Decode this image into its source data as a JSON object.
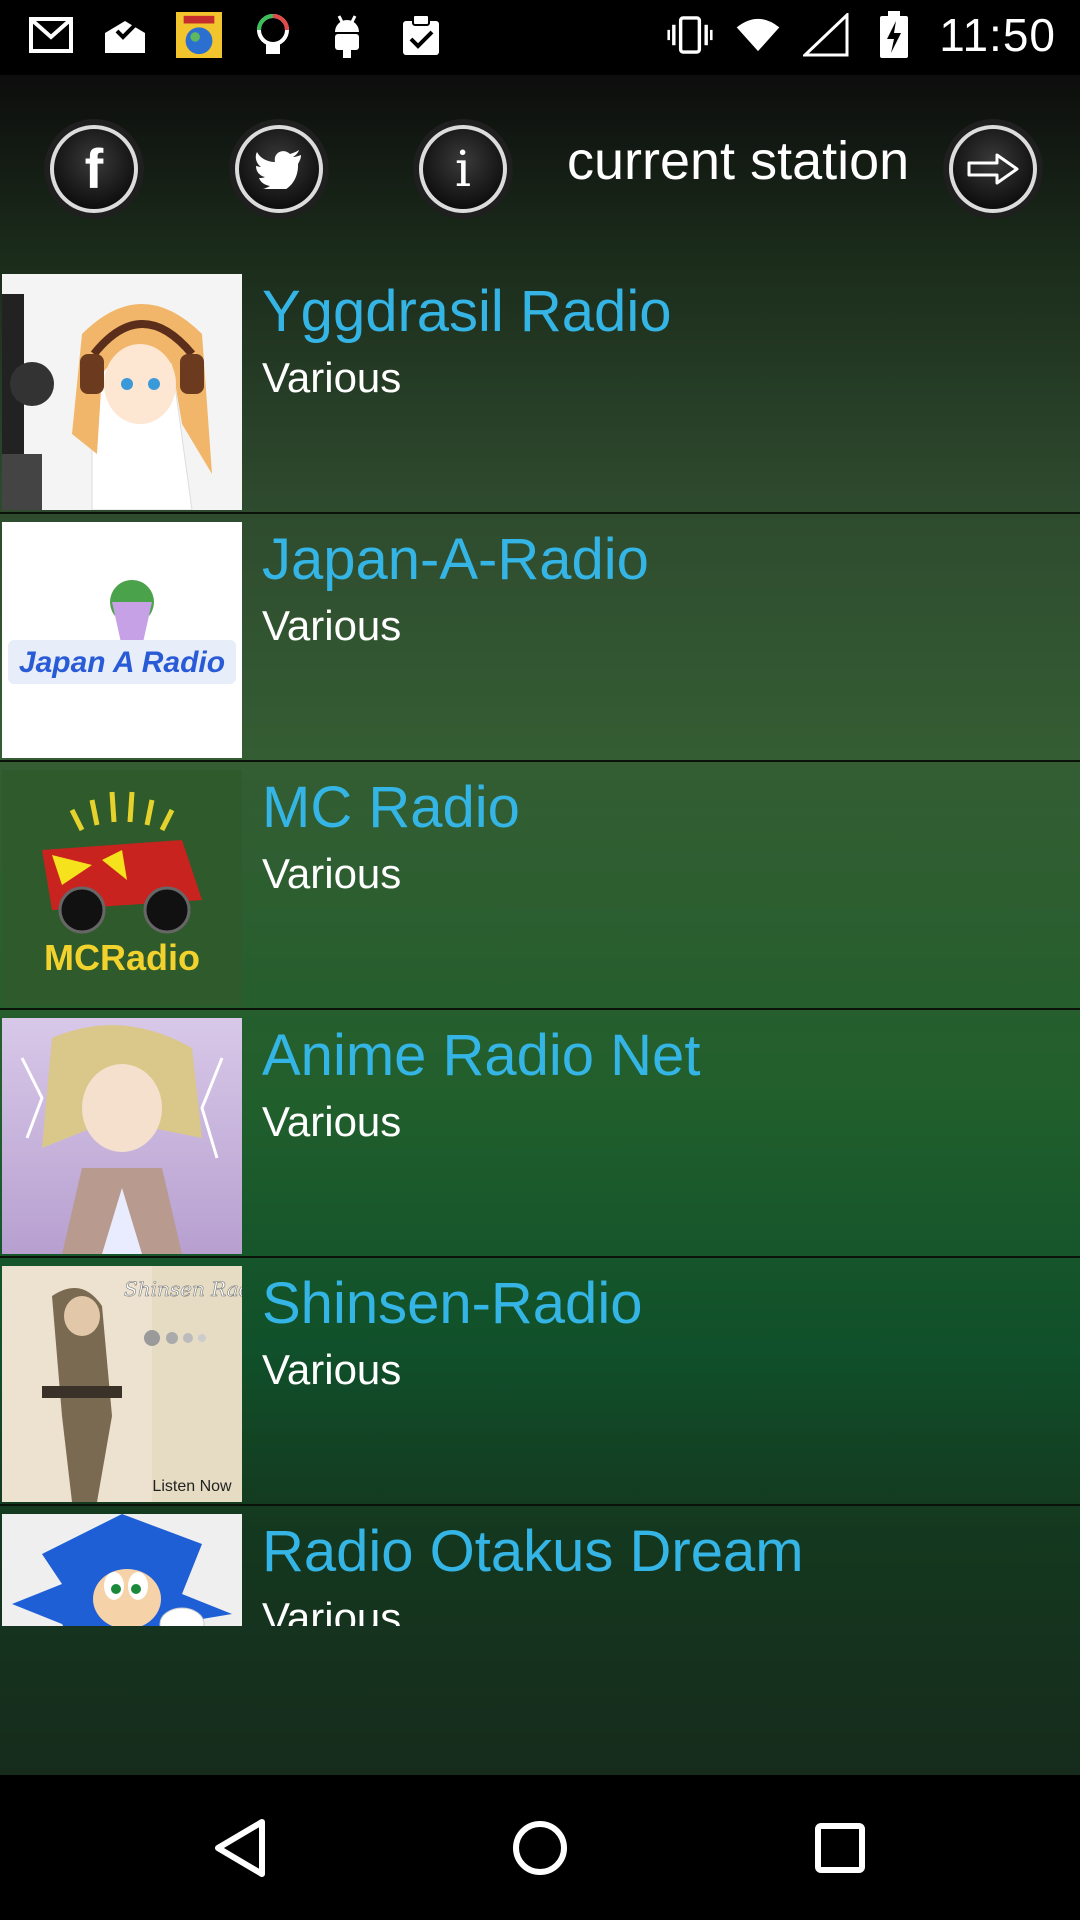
{
  "status_bar": {
    "time": "11:50",
    "left_icons": [
      "gmail-icon",
      "mail-check-icon",
      "radio-app-icon",
      "bulb-icon",
      "android-icon",
      "clipboard-check-icon"
    ],
    "right_icons": [
      "vibrate-icon",
      "wifi-icon",
      "signal-icon",
      "battery-charging-icon"
    ]
  },
  "toolbar": {
    "facebook_icon": "facebook-icon",
    "twitter_icon": "twitter-icon",
    "info_icon": "info-icon",
    "current_station_label": "current station",
    "next_icon": "arrow-right-icon"
  },
  "stations": [
    {
      "name": "Yggdrasil Radio",
      "genre": "Various"
    },
    {
      "name": "Japan-A-Radio",
      "genre": "Various"
    },
    {
      "name": "MC Radio",
      "genre": "Various"
    },
    {
      "name": "Anime Radio Net",
      "genre": "Various"
    },
    {
      "name": "Shinsen-Radio",
      "genre": "Various"
    },
    {
      "name": "Radio Otakus Dream",
      "genre": "Various"
    }
  ],
  "thumb_text": {
    "japan_logo": "Japan A Radio",
    "mc_logo": "MCRadio",
    "shinsen_title": "Shinsen Radio",
    "shinsen_listen": "Listen Now"
  },
  "nav_bar": {
    "back_icon": "back-icon",
    "home_icon": "home-icon",
    "recent_icon": "recent-apps-icon"
  },
  "colors": {
    "station_name": "#35b5e5",
    "genre_text": "#ffffff",
    "status_bar_bg": "#000000"
  }
}
